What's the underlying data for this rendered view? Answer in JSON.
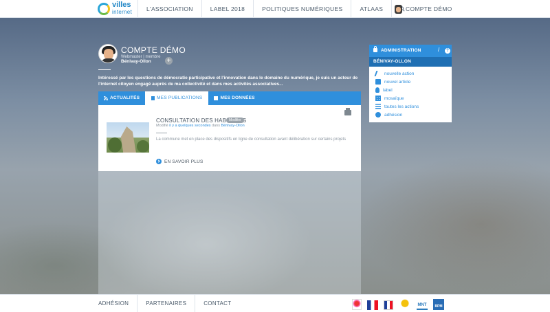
{
  "brand": {
    "line1": "villes",
    "line2": "internet"
  },
  "nav": {
    "items": [
      "L'ASSOCIATION",
      "LABEL 2018",
      "POLITIQUES NUMÉRIQUES",
      "ATLAAS"
    ],
    "account_label": "COMPTE DÉMO"
  },
  "profile": {
    "name": "COMPTE DÉMO",
    "role": "Webmaster | membre",
    "city": "Bénivay-Ollon",
    "bio": "Intéressé par les questions de démocratie participative et l'innovation dans le domaine du numérique, je suis un acteur de l'internet citoyen engagé auprès de ma collectivité et dans mes activités associatives..."
  },
  "tabs": [
    {
      "label": "ACTUALITÉS",
      "icon": "rss-icon"
    },
    {
      "label": "MES PUBLICATIONS",
      "icon": "document-icon"
    },
    {
      "label": "MES DONNÉES",
      "icon": "data-icon"
    }
  ],
  "publication": {
    "title": "CONSULTATION DES HABITANTS",
    "badge": "Modifier",
    "meta_prefix": "Modifié",
    "meta_time": "il y a quelques secondes",
    "meta_in": "dans",
    "meta_place": "Bénivay-Ollon",
    "description": "La commune met en place des dispositifs en ligne de consultation avant délibération sur certains projets",
    "more_label": "EN SAVOIR PLUS"
  },
  "admin": {
    "title": "ADMINISTRATION",
    "help": "?",
    "place": "BÉNIVAY-OLLON",
    "items": [
      {
        "label": "nouvelle action",
        "icon": "pen-icon"
      },
      {
        "label": "nouvel article",
        "icon": "article-icon"
      },
      {
        "label": "label",
        "icon": "label-icon"
      },
      {
        "label": "mosaïque",
        "icon": "grid-icon"
      },
      {
        "label": "toutes les actions",
        "icon": "list-icon"
      },
      {
        "label": "adhésion",
        "icon": "membership-icon"
      }
    ]
  },
  "footer": {
    "links": [
      "ADHÉSION",
      "PARTENAIRES",
      "CONTACT"
    ],
    "partner_mnt": "MNT",
    "partner_bpm": "BPM"
  },
  "colors": {
    "accent": "#2f8fdc",
    "accent_dark": "#1f6fb3",
    "text": "#4a5a6a"
  }
}
